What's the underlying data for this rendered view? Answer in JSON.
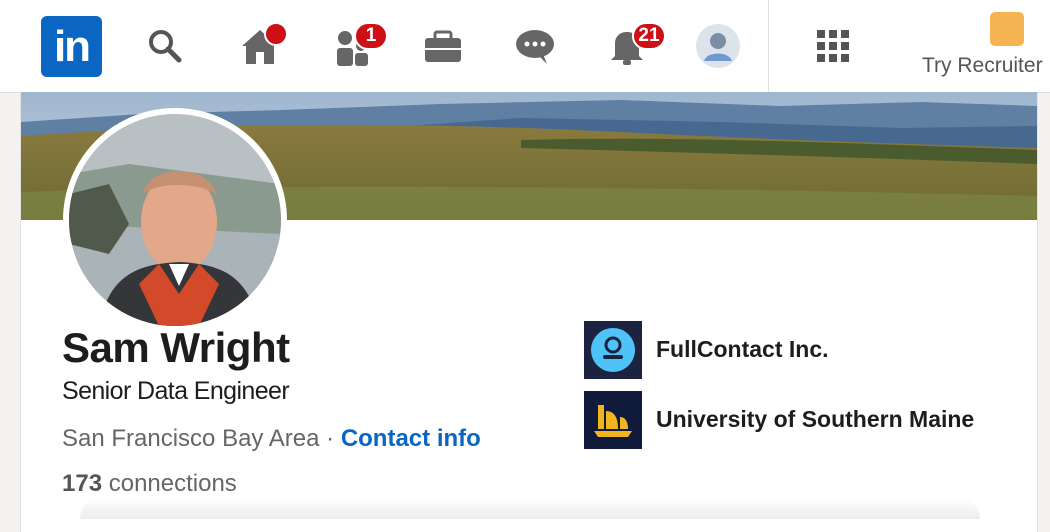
{
  "nav": {
    "logo_text": "in",
    "items": [
      {
        "icon": "search-icon"
      },
      {
        "icon": "home-icon",
        "badge": ""
      },
      {
        "icon": "my-network-icon",
        "badge": "1"
      },
      {
        "icon": "jobs-icon"
      },
      {
        "icon": "messaging-icon"
      },
      {
        "icon": "notifications-icon",
        "badge": "21"
      },
      {
        "icon": "profile-avatar"
      },
      {
        "icon": "apps-grid-icon"
      }
    ],
    "recruiter_label": "Try Recruiter",
    "badge_color": "#cc1016",
    "brand_color": "#0a66c2"
  },
  "profile": {
    "name": "Sam Wright",
    "headline": "Senior Data Engineer",
    "location": "San Francisco Bay Area",
    "separator": "·",
    "contact_label": "Contact info",
    "connections_count": "173",
    "connections_label": "connections"
  },
  "orgs": [
    {
      "name": "FullContact Inc.",
      "icon": "fullcontact-logo"
    },
    {
      "name": "University of Southern Maine",
      "icon": "usm-logo"
    }
  ]
}
